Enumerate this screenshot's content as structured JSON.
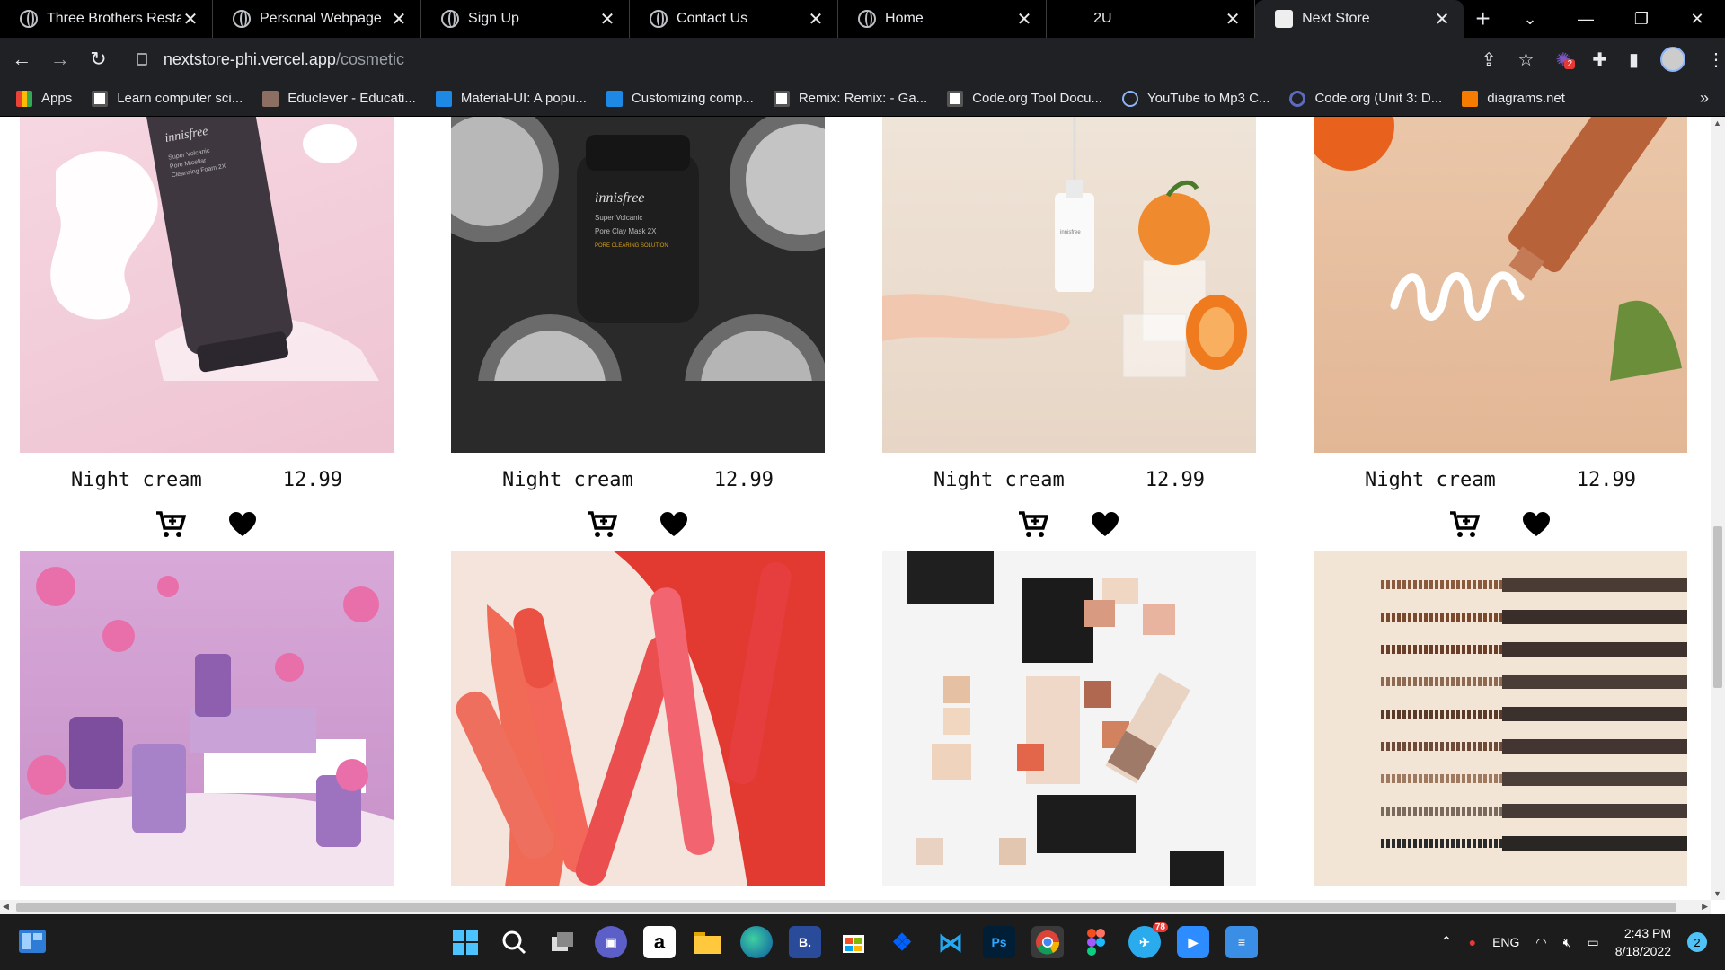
{
  "browser": {
    "tabs": [
      {
        "title": "Three Brothers Restau",
        "favicon": "globe-icon",
        "active": false
      },
      {
        "title": "Personal Webpage",
        "favicon": "globe-icon",
        "active": false
      },
      {
        "title": "Sign Up",
        "favicon": "globe-icon",
        "active": false
      },
      {
        "title": "Contact Us",
        "favicon": "globe-icon",
        "active": false
      },
      {
        "title": "Home",
        "favicon": "globe-icon",
        "active": false
      },
      {
        "title": "2U",
        "favicon": "dot-icon",
        "active": false
      },
      {
        "title": "Next Store",
        "favicon": "next-store-icon",
        "active": true
      }
    ],
    "url_host": "nextstore-phi.vercel.app",
    "url_path": "/cosmetic",
    "extension_badge": "2",
    "bookmarks": [
      {
        "label": "Apps",
        "icon": "apps-grid-icon"
      },
      {
        "label": "Learn computer sci...",
        "icon": "code-icon"
      },
      {
        "label": "Educlever - Educati...",
        "icon": "educlever-icon"
      },
      {
        "label": "Material-UI: A popu...",
        "icon": "material-ui-icon"
      },
      {
        "label": "Customizing comp...",
        "icon": "material-ui-icon"
      },
      {
        "label": "Remix: Remix: - Ga...",
        "icon": "code-icon"
      },
      {
        "label": "Code.org Tool Docu...",
        "icon": "code-icon"
      },
      {
        "label": "YouTube to Mp3 C...",
        "icon": "cloud-download-icon"
      },
      {
        "label": "Code.org (Unit 3: D...",
        "icon": "search-icon"
      },
      {
        "label": "diagrams.net",
        "icon": "diagrams-icon"
      }
    ],
    "bookmarks_more": "»"
  },
  "products_row1": [
    {
      "name": "Night cream",
      "price": "12.99",
      "image": "innisfree cleansing foam tube"
    },
    {
      "name": "Night cream",
      "price": "12.99",
      "image": "innisfree clay mask jar"
    },
    {
      "name": "Night cream",
      "price": "12.99",
      "image": "serum bottle with orange"
    },
    {
      "name": "Night cream",
      "price": "12.99",
      "image": "peel treatment tube"
    }
  ],
  "products_row2": [
    {
      "image": "orchid set"
    },
    {
      "image": "lip tints"
    },
    {
      "image": "eyeshadow palette 15%"
    },
    {
      "image": "auto liners"
    }
  ],
  "taskbar": {
    "telegram_badge": "78",
    "language": "ENG",
    "time": "2:43 PM",
    "date": "8/18/2022",
    "notifications": "2"
  },
  "colors": {
    "tab_strip": "#000000",
    "toolbar": "#202124",
    "taskbar": "#1c1c1c",
    "accent": "#8ab4f8"
  }
}
